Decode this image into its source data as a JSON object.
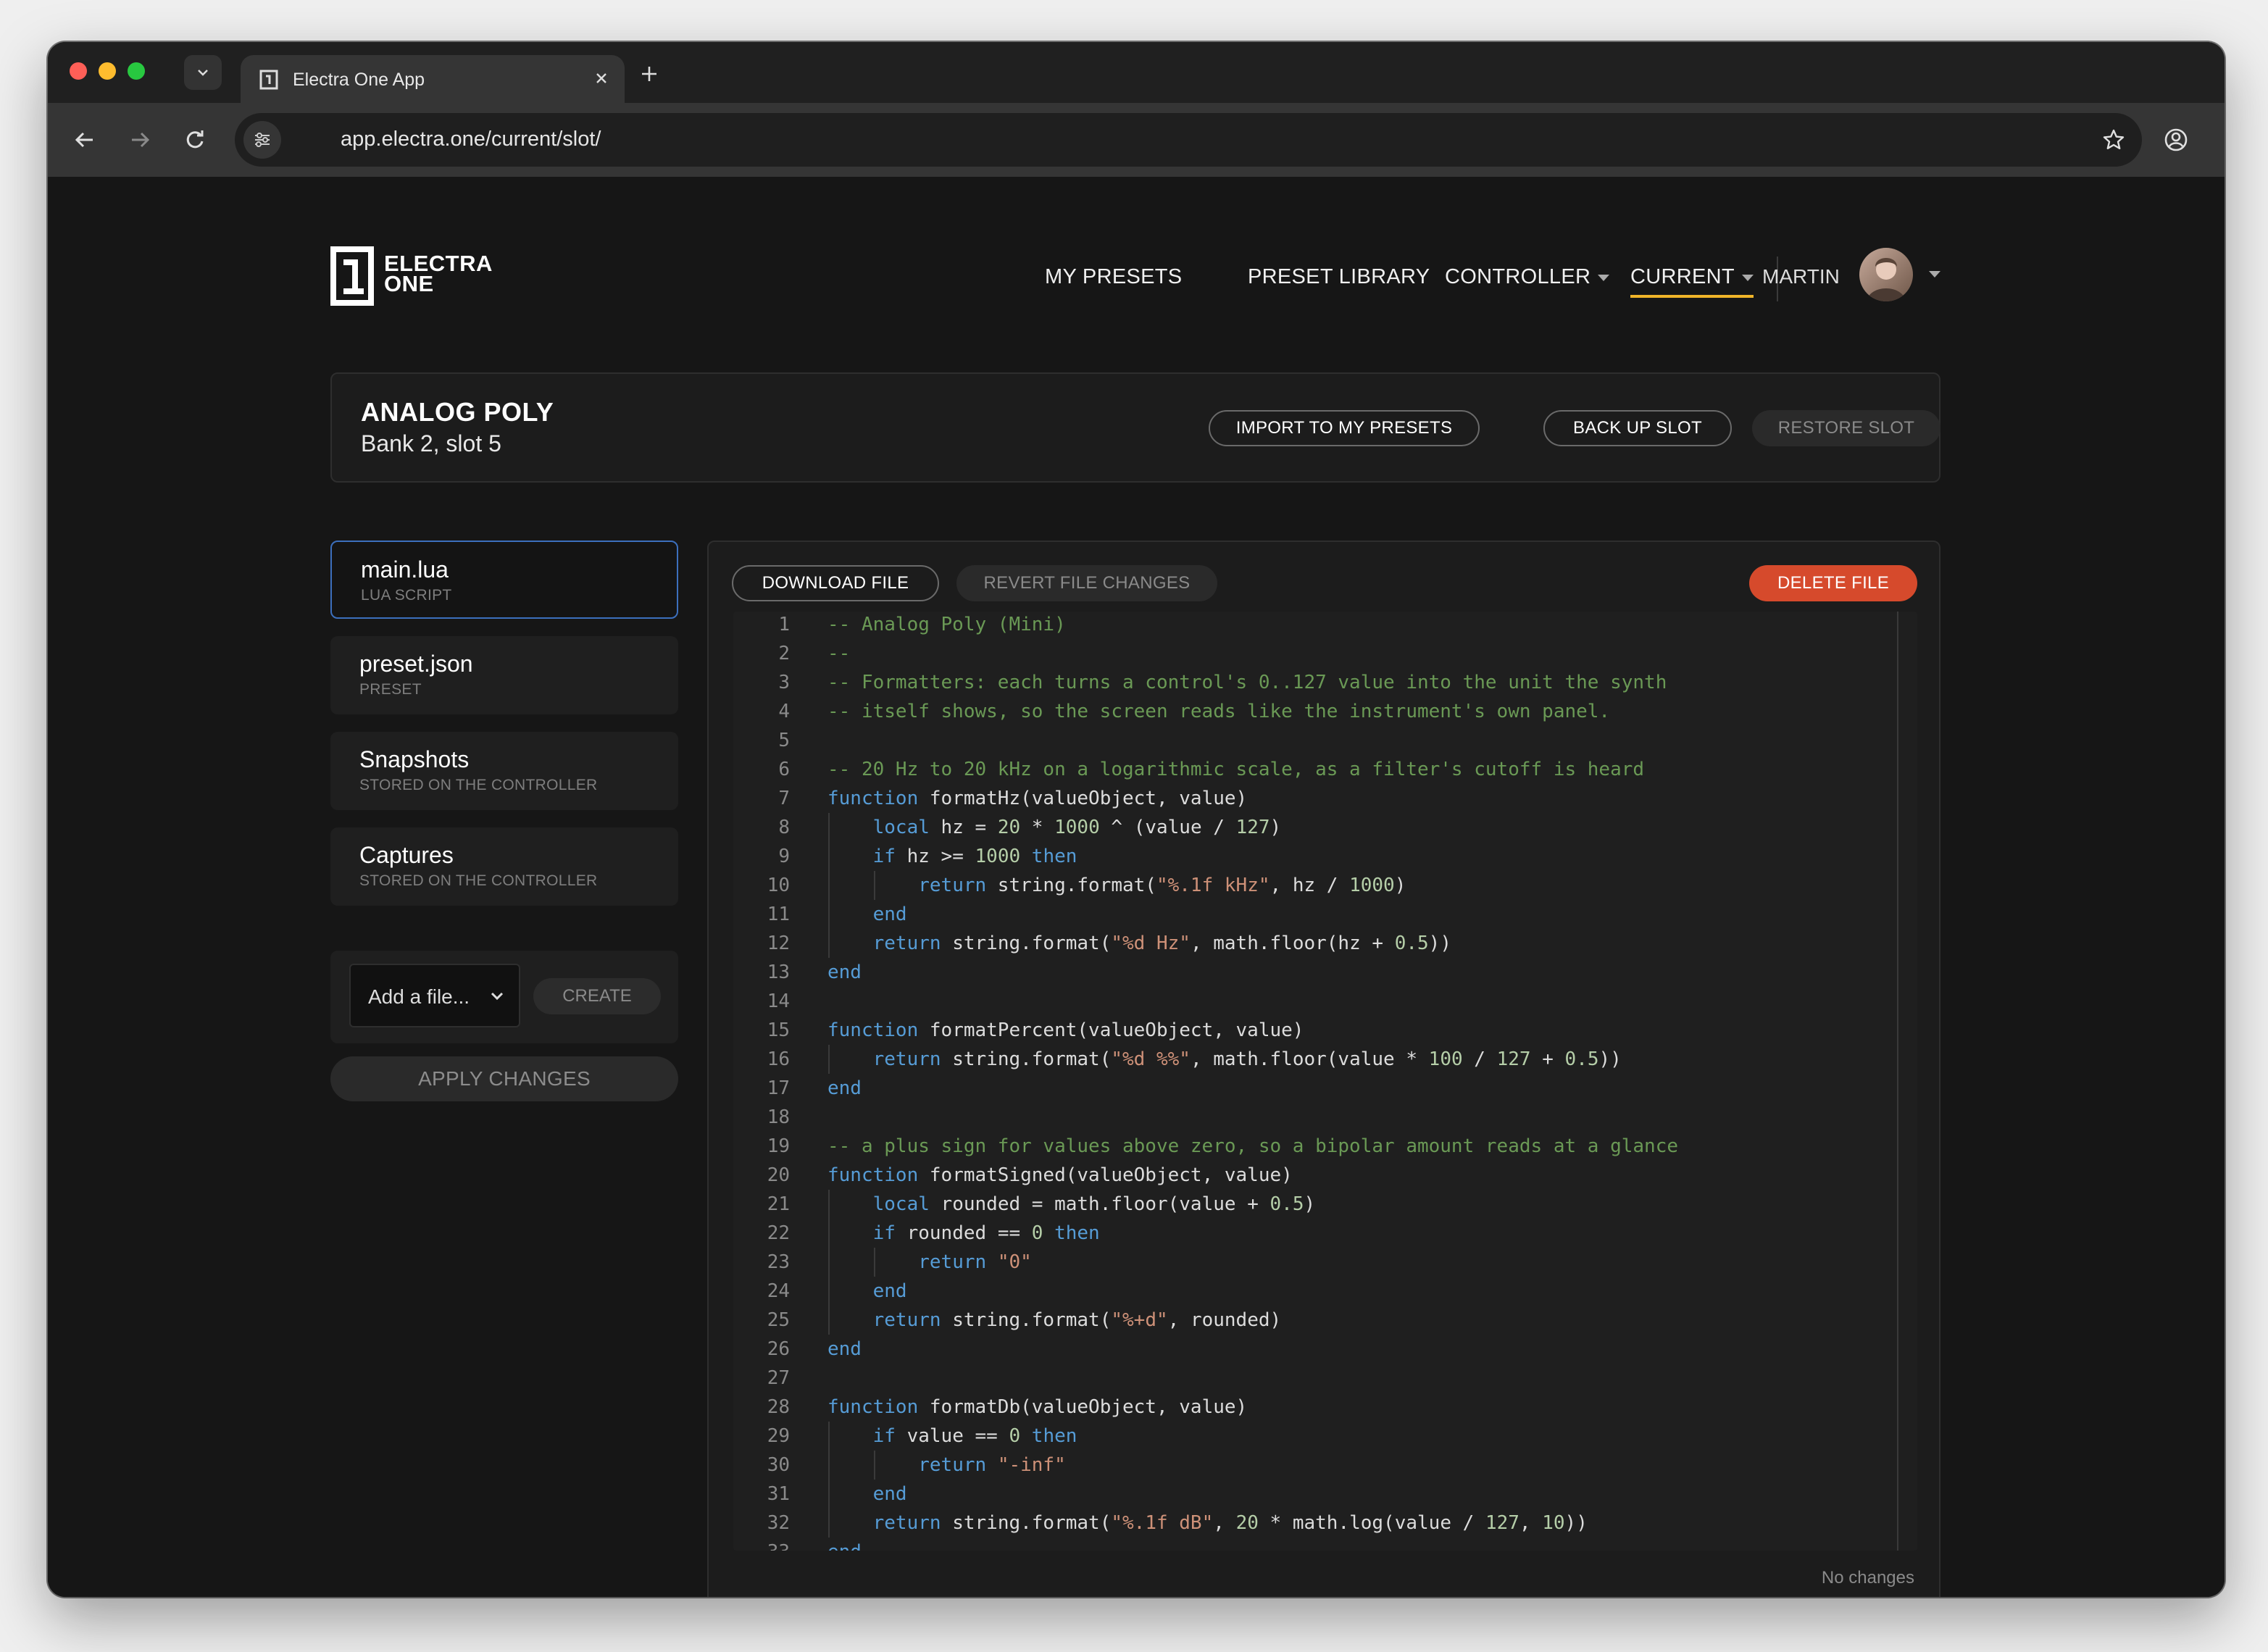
{
  "browser": {
    "tab_title": "Electra One App",
    "url": "app.electra.one/current/slot/"
  },
  "brand": {
    "logo_line1": "ELECTRA",
    "logo_line2": "ONE"
  },
  "nav": {
    "my_presets": "MY PRESETS",
    "preset_library": "PRESET LIBRARY",
    "controller": "CONTROLLER",
    "current": "CURRENT",
    "user": "MARTIN"
  },
  "slot": {
    "title": "ANALOG POLY",
    "subtitle": "Bank 2, slot 5",
    "import_label": "IMPORT TO MY PRESETS",
    "backup_label": "BACK UP SLOT",
    "restore_label": "RESTORE SLOT"
  },
  "files": [
    {
      "name": "main.lua",
      "type": "LUA SCRIPT"
    },
    {
      "name": "preset.json",
      "type": "PRESET"
    },
    {
      "name": "Snapshots",
      "type": "STORED ON THE CONTROLLER"
    },
    {
      "name": "Captures",
      "type": "STORED ON THE CONTROLLER"
    }
  ],
  "add_file": {
    "placeholder": "Add a file...",
    "create_label": "CREATE"
  },
  "apply_label": "APPLY CHANGES",
  "editor": {
    "download_label": "DOWNLOAD FILE",
    "revert_label": "REVERT FILE CHANGES",
    "delete_label": "DELETE FILE",
    "status": "No changes",
    "code": [
      "-- Analog Poly (Mini)",
      "--",
      "-- Formatters: each turns a control's 0..127 value into the unit the synth",
      "-- itself shows, so the screen reads like the instrument's own panel.",
      "",
      "-- 20 Hz to 20 kHz on a logarithmic scale, as a filter's cutoff is heard",
      "function formatHz(valueObject, value)",
      "    local hz = 20 * 1000 ^ (value / 127)",
      "    if hz >= 1000 then",
      "        return string.format(\"%.1f kHz\", hz / 1000)",
      "    end",
      "    return string.format(\"%d Hz\", math.floor(hz + 0.5))",
      "end",
      "",
      "function formatPercent(valueObject, value)",
      "    return string.format(\"%d %%\", math.floor(value * 100 / 127 + 0.5))",
      "end",
      "",
      "-- a plus sign for values above zero, so a bipolar amount reads at a glance",
      "function formatSigned(valueObject, value)",
      "    local rounded = math.floor(value + 0.5)",
      "    if rounded == 0 then",
      "        return \"0\"",
      "    end",
      "    return string.format(\"%+d\", rounded)",
      "end",
      "",
      "function formatDb(valueObject, value)",
      "    if value == 0 then",
      "        return \"-inf\"",
      "    end",
      "    return string.format(\"%.1f dB\", 20 * math.log(value / 127, 10))",
      "end"
    ]
  },
  "colors": {
    "accent": "#f0b429",
    "danger": "#d64a2c",
    "active_border": "#3c6fbd"
  }
}
